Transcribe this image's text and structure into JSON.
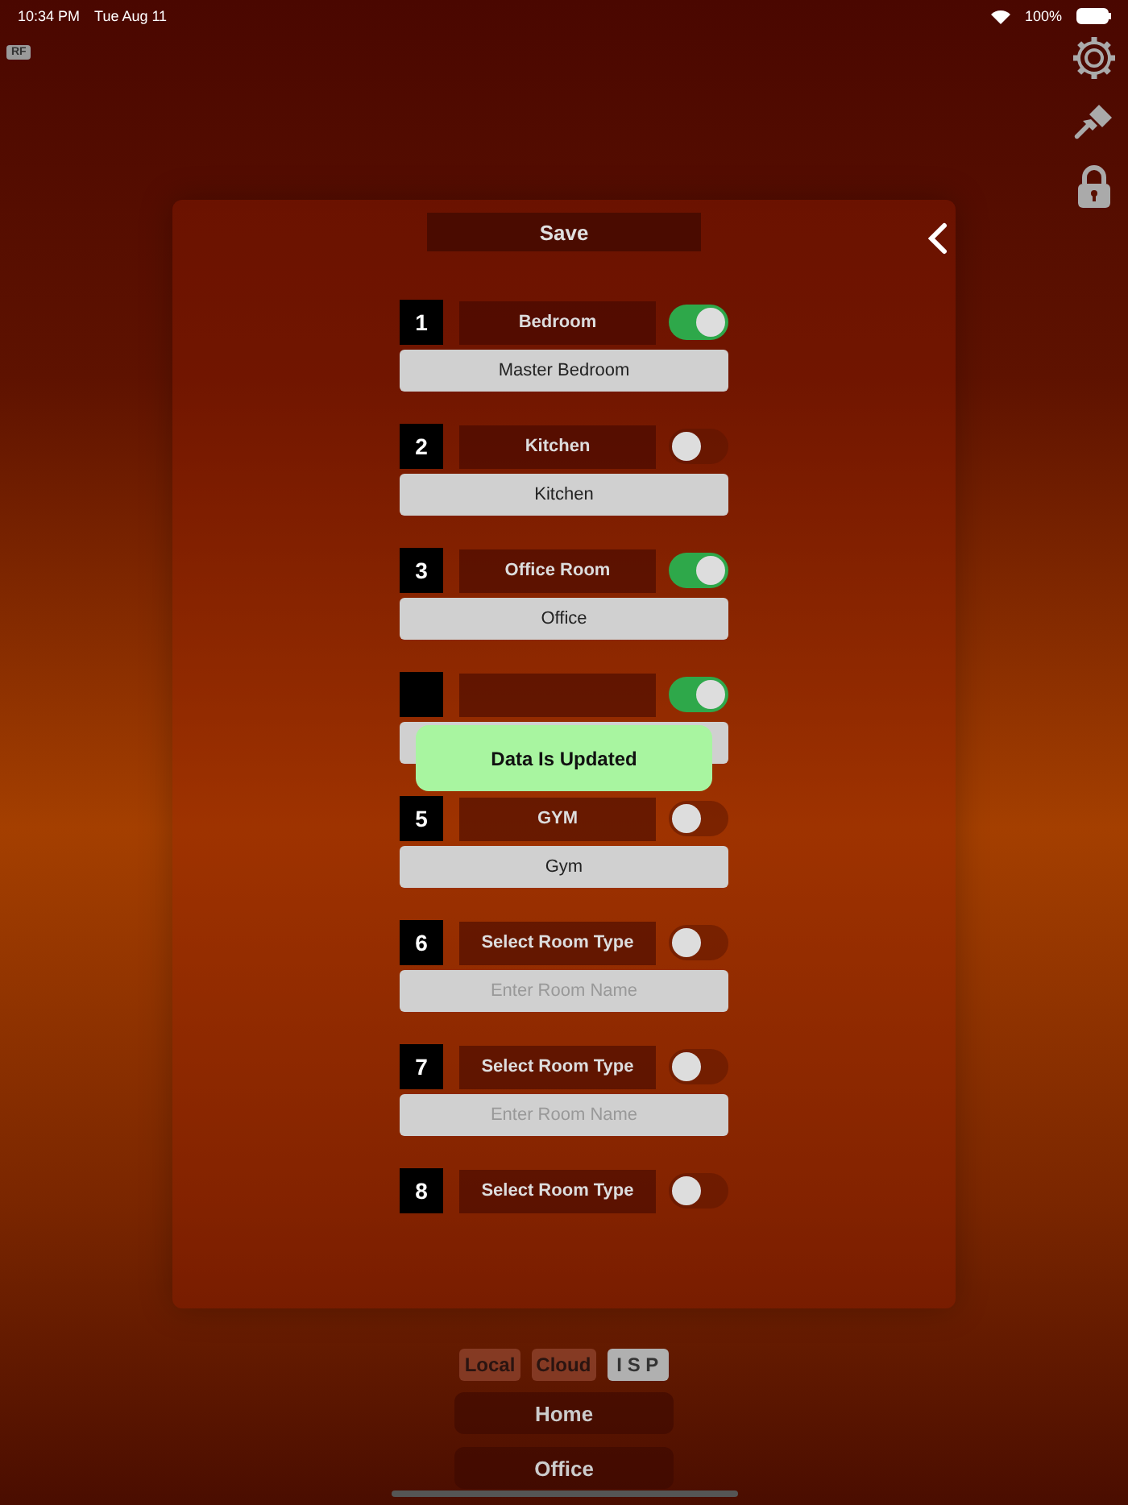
{
  "status_bar": {
    "time": "10:34 PM",
    "date": "Tue Aug 11",
    "battery_text": "100%"
  },
  "badge": "RF",
  "save_button": "Save",
  "rooms": [
    {
      "number": "1",
      "type": "Bedroom",
      "on": true,
      "name": "Master Bedroom"
    },
    {
      "number": "2",
      "type": "Kitchen",
      "on": false,
      "name": "Kitchen"
    },
    {
      "number": "3",
      "type": "Office Room",
      "on": true,
      "name": "Office"
    },
    {
      "on": true
    },
    {
      "number": "5",
      "type": "GYM",
      "on": false,
      "name": "Gym"
    },
    {
      "number": "6",
      "type": "Select Room Type",
      "on": false,
      "placeholder": "Enter Room Name"
    },
    {
      "number": "7",
      "type": "Select Room Type",
      "on": false,
      "placeholder": "Enter Room Name"
    },
    {
      "number": "8",
      "type": "Select Room Type",
      "on": false
    }
  ],
  "toast": "Data Is Updated",
  "modes": [
    {
      "label": "Local",
      "selected": false
    },
    {
      "label": "Cloud",
      "selected": false
    },
    {
      "label": "I S P",
      "selected": true
    }
  ],
  "sites": [
    "Home",
    "Office"
  ]
}
